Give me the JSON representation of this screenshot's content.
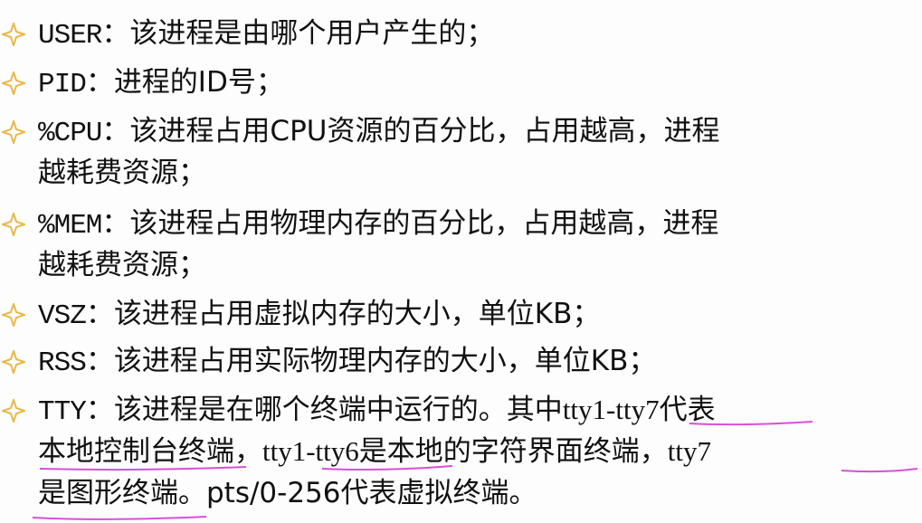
{
  "bullet_icon": "diamond-star-outline-icon",
  "accent_color": "#e8b84a",
  "annotation_color": "#d94fd9",
  "items": [
    {
      "key": "USER",
      "sep": "：",
      "desc": "该进程是由哪个用户产生的；"
    },
    {
      "key": "PID",
      "sep": "：",
      "desc": "进程的ID号；"
    },
    {
      "key": "%CPU",
      "sep": "：",
      "desc1": "该进程占用CPU资源的百分比，占用越高，进程",
      "desc2": "越耗费资源；"
    },
    {
      "key": "%MEM",
      "sep": "：",
      "desc1": "该进程占用物理内存的百分比，占用越高，进程",
      "desc2": "越耗费资源；"
    },
    {
      "key": "VSZ",
      "sep": "：",
      "desc": "该进程占用虚拟内存的大小，单位KB；"
    },
    {
      "key": "RSS",
      "sep": "：",
      "desc": "该进程占用实际物理内存的大小，单位KB；"
    },
    {
      "key": "TTY",
      "sep": "：",
      "line1_a": "该进程是在哪个终端中运行的。其中",
      "line1_b": "tty1-tty7",
      "line1_c": "代表",
      "line2_a": "本地控制台终端",
      "line2_b": "，",
      "line2_c": "tty1-tty6",
      "line2_d": "是本地的字符界面终端，",
      "line2_e": "tty7",
      "line3_a": "是图形终端",
      "line3_b": "。pts/0-256代表虚拟终端。"
    }
  ]
}
